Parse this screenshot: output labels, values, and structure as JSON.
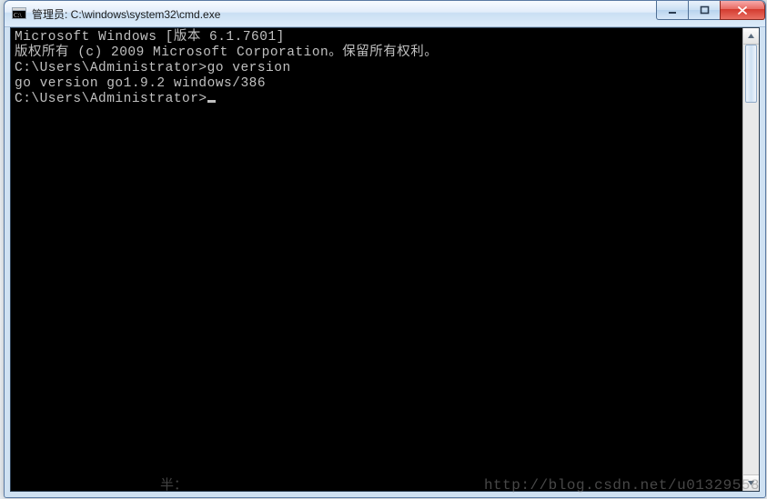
{
  "titlebar": {
    "title": "管理员: C:\\windows\\system32\\cmd.exe"
  },
  "terminal": {
    "lines": [
      "Microsoft Windows [版本 6.1.7601]",
      "版权所有 (c) 2009 Microsoft Corporation。保留所有权利。",
      "",
      "C:\\Users\\Administrator>go version",
      "go version go1.9.2 windows/386",
      "",
      "C:\\Users\\Administrator>"
    ]
  },
  "watermark": "http://blog.csdn.net/u01329558",
  "stray": "半："
}
